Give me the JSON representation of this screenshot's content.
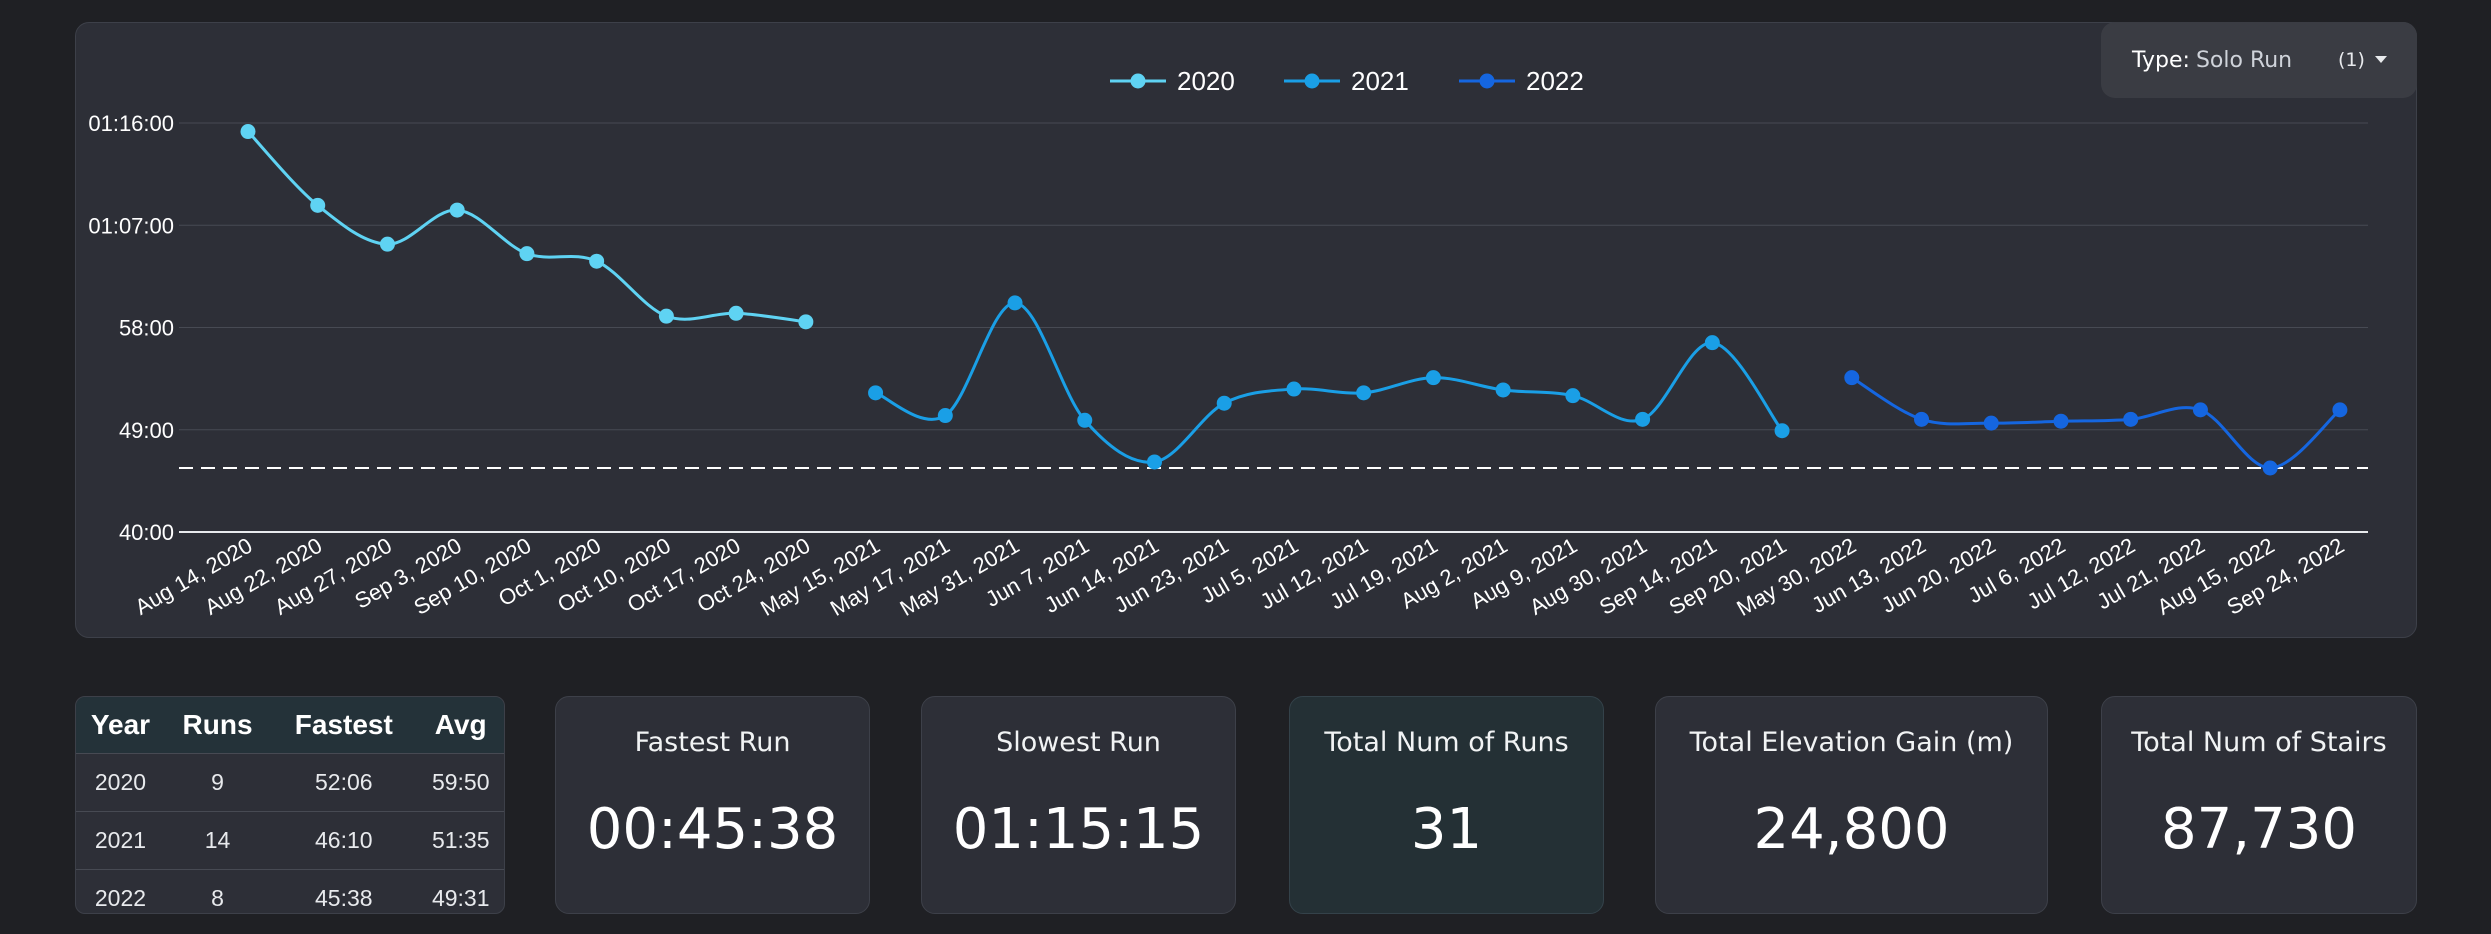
{
  "filter": {
    "label": "Type:",
    "value": "Solo Run",
    "count": "(1)"
  },
  "colors": {
    "2020": "#5fd3f3",
    "2021": "#1a9fe6",
    "2022": "#1566e0"
  },
  "chart_data": {
    "type": "line",
    "title": "",
    "xlabel": "",
    "ylabel": "",
    "legend_position": "top-center",
    "grid": true,
    "y_tick_labels": [
      "40:00",
      "49:00",
      "58:00",
      "01:07:00",
      "01:16:00"
    ],
    "y_ticks_seconds": [
      2400,
      2940,
      3480,
      4020,
      4560
    ],
    "ylim_seconds": [
      2400,
      4560
    ],
    "reference_line": {
      "label": "",
      "value": "45:38",
      "value_seconds": 2738
    },
    "categories": [
      "Aug 14, 2020",
      "Aug 22, 2020",
      "Aug 27, 2020",
      "Sep 3, 2020",
      "Sep 10, 2020",
      "Oct 1, 2020",
      "Oct 10, 2020",
      "Oct 17, 2020",
      "Oct 24, 2020",
      "May 15, 2021",
      "May 17, 2021",
      "May 31, 2021",
      "Jun 7, 2021",
      "Jun 14, 2021",
      "Jun 23, 2021",
      "Jul 5, 2021",
      "Jul 12, 2021",
      "Jul 19, 2021",
      "Aug 2, 2021",
      "Aug 9, 2021",
      "Aug 30, 2021",
      "Sep 14, 2021",
      "Sep 20, 2021",
      "May 30, 2022",
      "Jun 13, 2022",
      "Jun 20, 2022",
      "Jul 6, 2022",
      "Jul 12, 2022",
      "Jul 21, 2022",
      "Aug 15, 2022",
      "Sep 24, 2022"
    ],
    "series": [
      {
        "name": "2020",
        "start_index": 0,
        "values": [
          "01:15:15",
          "01:08:45",
          "01:05:20",
          "01:08:20",
          "01:04:30",
          "01:03:50",
          "59:00",
          "59:15",
          "58:30"
        ],
        "values_seconds": [
          4515,
          4125,
          3920,
          4100,
          3870,
          3830,
          3540,
          3555,
          3510
        ]
      },
      {
        "name": "2021",
        "start_index": 9,
        "values": [
          "52:15",
          "50:15",
          "01:00:10",
          "49:50",
          "46:10",
          "51:20",
          "52:35",
          "52:15",
          "53:35",
          "52:30",
          "52:00",
          "49:55",
          "56:40",
          "48:55"
        ],
        "values_seconds": [
          3135,
          3015,
          3610,
          2990,
          2770,
          3080,
          3155,
          3135,
          3215,
          3150,
          3120,
          2995,
          3400,
          2935
        ]
      },
      {
        "name": "2022",
        "start_index": 23,
        "values": [
          "53:35",
          "49:55",
          "49:35",
          "49:45",
          "49:55",
          "50:45",
          "45:38",
          "50:45"
        ],
        "values_seconds": [
          3215,
          2995,
          2975,
          2985,
          2995,
          3045,
          2738,
          3045
        ]
      }
    ]
  },
  "table": {
    "headers": [
      "Year",
      "Runs",
      "Fastest",
      "Avg"
    ],
    "rows": [
      [
        "2020",
        "9",
        "52:06",
        "59:50"
      ],
      [
        "2021",
        "14",
        "46:10",
        "51:35"
      ],
      [
        "2022",
        "8",
        "45:38",
        "49:31"
      ]
    ]
  },
  "kpis": {
    "fastest": {
      "title": "Fastest Run",
      "value": "00:45:38"
    },
    "slowest": {
      "title": "Slowest Run",
      "value": "01:15:15"
    },
    "total_runs": {
      "title": "Total Num of Runs",
      "value": "31"
    },
    "elevation": {
      "title": "Total Elevation Gain (m)",
      "value": "24,800"
    },
    "stairs": {
      "title": "Total Num of Stairs",
      "value": "87,730"
    }
  }
}
